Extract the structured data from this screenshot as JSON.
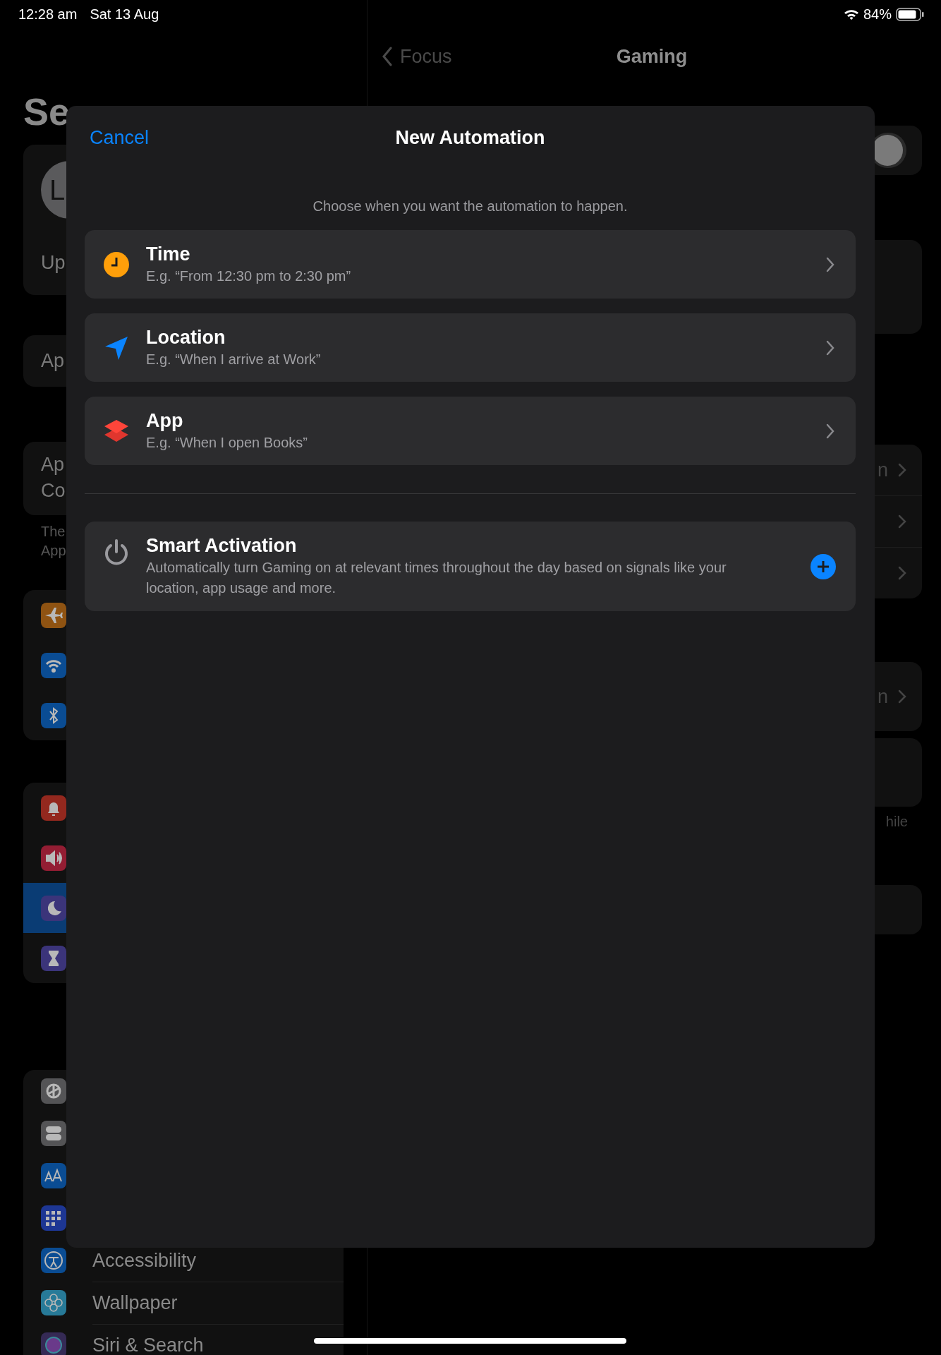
{
  "status_bar": {
    "time": "12:28 am",
    "date": "Sat 13 Aug",
    "battery": "84%"
  },
  "sidebar": {
    "title": "Se",
    "profile": {
      "avatar": "L",
      "label": "Up"
    },
    "account_row": {
      "label": "Ap"
    },
    "notice": {
      "lines": [
        "Ap",
        "Co"
      ],
      "footnote_lines": [
        "The",
        "App"
      ]
    },
    "groups": [
      {
        "items": [
          {
            "kind": "airplane",
            "color": "#8f5312",
            "selected": false
          },
          {
            "kind": "wifi",
            "color": "#0a4c93",
            "selected": false
          },
          {
            "kind": "bluetooth",
            "color": "#0a4c93",
            "selected": false
          }
        ]
      },
      {
        "items": [
          {
            "kind": "bell",
            "color": "#93281e",
            "selected": false
          },
          {
            "kind": "speaker",
            "color": "#931d33",
            "selected": false
          },
          {
            "kind": "moon",
            "color": "#3b347a",
            "selected": true
          },
          {
            "kind": "hourglass",
            "color": "#3b347a",
            "selected": false
          }
        ]
      },
      {
        "items": [
          {
            "kind": "gear",
            "color": "#545456",
            "selected": false
          },
          {
            "kind": "toggles",
            "color": "#545456",
            "selected": false
          },
          {
            "kind": "textsize",
            "color": "#0a4c93",
            "selected": false
          },
          {
            "kind": "grid",
            "color": "#1d3693",
            "selected": false
          },
          {
            "kind": "accessibility",
            "color": "#0a4c93",
            "label": "Accessibility",
            "selected": false
          },
          {
            "kind": "flower",
            "color": "#277a98",
            "label": "Wallpaper",
            "selected": false
          },
          {
            "kind": "siri",
            "color": "#352a55",
            "label": "Siri & Search",
            "selected": false
          }
        ]
      }
    ]
  },
  "detail": {
    "back": "Focus",
    "title": "Gaming",
    "sections": [
      {
        "kind": "toggle",
        "on": false
      },
      {
        "kind": "card"
      },
      {
        "kind": "list",
        "rows": [
          {
            "value": "n",
            "chevron": true
          },
          {
            "chevron": true
          },
          {
            "chevron": true
          }
        ]
      },
      {
        "kind": "list",
        "rows": [
          {
            "value": "n",
            "chevron": true
          }
        ]
      },
      {
        "kind": "card",
        "footer": "hile"
      },
      {
        "kind": "card"
      }
    ]
  },
  "sheet": {
    "cancel": "Cancel",
    "title": "New Automation",
    "subtitle": "Choose when you want the automation to happen.",
    "triggers": [
      {
        "kind": "time",
        "title": "Time",
        "example": "E.g. “From 12:30 pm to 2:30 pm”"
      },
      {
        "kind": "location",
        "title": "Location",
        "example": "E.g. “When I arrive at Work”"
      },
      {
        "kind": "app",
        "title": "App",
        "example": "E.g. “When I open Books”"
      }
    ],
    "smart_activation": {
      "title": "Smart Activation",
      "description": "Automatically turn Gaming on at relevant times throughout the day based on signals like your location, app usage and more."
    }
  }
}
